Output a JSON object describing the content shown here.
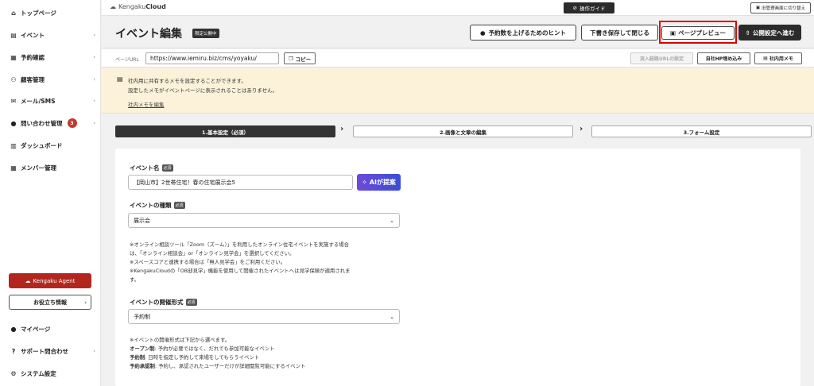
{
  "sidebar": {
    "items": [
      {
        "label": "トップページ",
        "icon": "home-icon",
        "glyph": "⌂",
        "chevron": false
      },
      {
        "label": "イベント",
        "icon": "document-icon",
        "glyph": "▤",
        "chevron": true
      },
      {
        "label": "予約確認",
        "icon": "calendar-icon",
        "glyph": "▦",
        "chevron": true
      },
      {
        "label": "顧客管理",
        "icon": "users-icon",
        "glyph": "⚇",
        "chevron": true
      },
      {
        "label": "メール/SMS",
        "icon": "mail-icon",
        "glyph": "✉",
        "chevron": true
      },
      {
        "label": "問い合わせ管理",
        "icon": "chat-icon",
        "glyph": "●",
        "chevron": true,
        "badge": "3"
      },
      {
        "label": "ダッシュボード",
        "icon": "chart-icon",
        "glyph": "▥",
        "chevron": false
      },
      {
        "label": "メンバー管理",
        "icon": "grid-icon",
        "glyph": "▦",
        "chevron": false
      }
    ],
    "agent_button": "Kengaku Agent",
    "tips_button": "お役立ち情報",
    "bottom_items": [
      {
        "label": "マイページ",
        "icon": "person-icon",
        "glyph": "●",
        "chevron": false
      },
      {
        "label": "サポート問合わせ",
        "icon": "help-icon",
        "glyph": "?",
        "chevron": true
      },
      {
        "label": "システム設定",
        "icon": "gear-icon",
        "glyph": "⚙",
        "chevron": false
      }
    ]
  },
  "topbar": {
    "logo_text": "Kengaku",
    "logo_bold": "Cloud",
    "guide_button": "操作ガイド",
    "switch_button": "旧管理画面に切り替え"
  },
  "header": {
    "title": "イベント編集",
    "status_badge": "限定公開中",
    "hint_button": "予約数を上げるためのヒント",
    "save_close_button": "下書き保存して閉じる",
    "preview_button": "ページプレビュー",
    "publish_button": "公開設定へ進む"
  },
  "urlbar": {
    "label": "ページURL",
    "url": "https://www.iemiru.biz/cms/yoyaku/",
    "copy_button": "コピー",
    "inflow_button": "流入経路URLの設定",
    "embed_button": "自社HP埋め込み",
    "memo_button": "社内用メモ"
  },
  "memo": {
    "line1": "社内用に共有するメモを設定することができます。",
    "line2": "設定したメモがイベントページに表示されることはありません。",
    "edit_link": "社内メモを編集"
  },
  "steps": [
    "1.基本設定（必須）",
    "2.画像と文章の編集",
    "3.フォーム設定"
  ],
  "form": {
    "required_tag": "必須",
    "event_name_label": "イベント名",
    "event_name_value": "【岡山市】2世帯住宅！春の住宅展示会5",
    "ai_button": "AIが提案",
    "event_type_label": "イベントの種類",
    "event_type_value": "展示会",
    "event_type_notes": [
      "※オンライン相談ツール「Zoom（ズーム）」を利用したオンライン住宅イベントを実施する場合",
      "は、「オンライン相談会」or「オンライン見学会」を選択してください。",
      "※スペースコアと連携する場合は「無人見学会」をご利用ください。",
      "※KengakuCloudの「OB邸見学」機能を使用して開催されたイベントへは見学保険が適用されま",
      "す。"
    ],
    "format_label": "イベントの開催形式",
    "format_value": "予約制",
    "format_note_intro": "※イベントの開催形式は下記から選べます。",
    "format_options": [
      {
        "name": "オープン制",
        "desc": ": 予約が必要ではなく、だれでも参加可能なイベント"
      },
      {
        "name": "予約制",
        "desc": ": 日時を指定し予約して来場をしてもらうイベント"
      },
      {
        "name": "予約承認制",
        "desc": ": 予約し、承認されたユーザーだけが詳細閲覧可能にするイベント"
      }
    ]
  },
  "colors": {
    "accent_dark": "#333333",
    "highlight": "#e00000",
    "agent_red": "#b3261e",
    "memo_bg": "#fbf2d9",
    "ai_gradient_start": "#6d4bd8",
    "ai_gradient_end": "#3b4cd6"
  }
}
